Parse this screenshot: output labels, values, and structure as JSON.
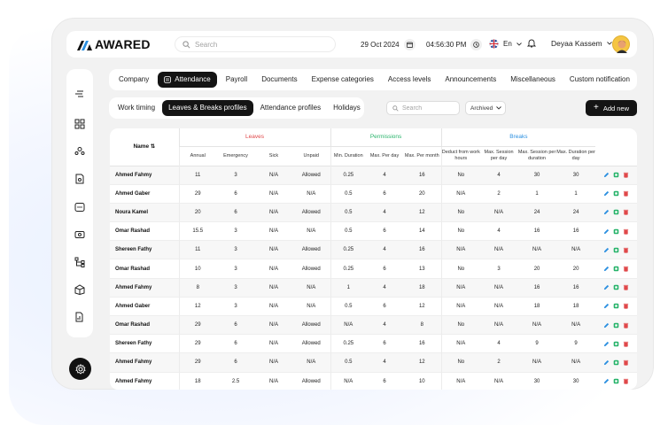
{
  "brand": {
    "name": "AWARED"
  },
  "topbar": {
    "search_placeholder": "Search",
    "date": "29 Oct 2024",
    "time": "04:56:30 PM",
    "language": "En",
    "user_name": "Deyaa Kassem"
  },
  "tabs_main": [
    {
      "label": "Company",
      "active": false
    },
    {
      "label": "Attendance",
      "active": true
    },
    {
      "label": "Payroll",
      "active": false
    },
    {
      "label": "Documents",
      "active": false
    },
    {
      "label": "Expense categories",
      "active": false
    },
    {
      "label": "Access levels",
      "active": false
    },
    {
      "label": "Announcements",
      "active": false
    },
    {
      "label": "Miscellaneous",
      "active": false
    },
    {
      "label": "Custom notification",
      "active": false
    }
  ],
  "tabs_sub": [
    {
      "label": "Work timing",
      "active": false
    },
    {
      "label": "Leaves & Breaks profiles",
      "active": true
    },
    {
      "label": "Attendance profiles",
      "active": false
    },
    {
      "label": "Holidays",
      "active": false
    }
  ],
  "filters": {
    "search_placeholder": "Search",
    "archived_label": "Archived",
    "add_new_label": "Add new"
  },
  "table": {
    "name_header": "Name",
    "groups": {
      "leaves": "Leaves",
      "permissions": "Permissions",
      "breaks": "Breaks"
    },
    "columns": [
      "Annual",
      "Emergency",
      "Sick",
      "Unpaid",
      "Min. Duration",
      "Max. Per day",
      "Max. Per month",
      "Deduct from work hours",
      "Max. Session per day",
      "Max. Session per duration",
      "Max. Duration per day"
    ],
    "rows": [
      [
        "Ahmed Fahmy",
        "11",
        "3",
        "N/A",
        "Allowed",
        "0.25",
        "4",
        "16",
        "No",
        "4",
        "30",
        "30"
      ],
      [
        "Ahmed Gaber",
        "29",
        "6",
        "N/A",
        "N/A",
        "0.5",
        "6",
        "20",
        "N/A",
        "2",
        "1",
        "1"
      ],
      [
        "Noura Kamel",
        "20",
        "6",
        "N/A",
        "Allowed",
        "0.5",
        "4",
        "12",
        "No",
        "N/A",
        "24",
        "24"
      ],
      [
        "Omar Rashad",
        "15.5",
        "3",
        "N/A",
        "N/A",
        "0.5",
        "6",
        "14",
        "No",
        "4",
        "16",
        "16"
      ],
      [
        "Shereen Fathy",
        "11",
        "3",
        "N/A",
        "Allowed",
        "0.25",
        "4",
        "16",
        "N/A",
        "N/A",
        "N/A",
        "N/A"
      ],
      [
        "Omar Rashad",
        "10",
        "3",
        "N/A",
        "Allowed",
        "0.25",
        "6",
        "13",
        "No",
        "3",
        "20",
        "20"
      ],
      [
        "Ahmed Fahmy",
        "8",
        "3",
        "N/A",
        "N/A",
        "1",
        "4",
        "18",
        "N/A",
        "N/A",
        "16",
        "16"
      ],
      [
        "Ahmed Gaber",
        "12",
        "3",
        "N/A",
        "N/A",
        "0.5",
        "6",
        "12",
        "N/A",
        "N/A",
        "18",
        "18"
      ],
      [
        "Omar Rashad",
        "29",
        "6",
        "N/A",
        "Allowed",
        "N/A",
        "4",
        "8",
        "No",
        "N/A",
        "N/A",
        "N/A"
      ],
      [
        "Shereen Fathy",
        "29",
        "6",
        "N/A",
        "Allowed",
        "0.25",
        "6",
        "16",
        "N/A",
        "4",
        "9",
        "9"
      ],
      [
        "Ahmed Fahmy",
        "29",
        "6",
        "N/A",
        "N/A",
        "0.5",
        "4",
        "12",
        "No",
        "2",
        "N/A",
        "N/A"
      ],
      [
        "Ahmed Fahmy",
        "18",
        "2.5",
        "N/A",
        "Allowed",
        "N/A",
        "6",
        "10",
        "N/A",
        "N/A",
        "30",
        "30"
      ]
    ]
  },
  "colors": {
    "leaves": "#e0484a",
    "permissions": "#27b36a",
    "breaks": "#2b8fe0",
    "edit_icon": "#2b8fe0",
    "copy_icon": "#27b36a",
    "delete_icon": "#e0484a"
  }
}
